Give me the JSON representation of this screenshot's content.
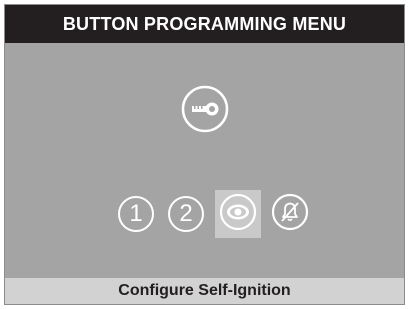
{
  "header": {
    "title": "BUTTON PROGRAMMING MENU"
  },
  "main_icon": {
    "icon": "key-icon"
  },
  "options": [
    {
      "label": "1",
      "icon": "circled-one-icon",
      "selected": false
    },
    {
      "label": "2",
      "icon": "circled-two-icon",
      "selected": false
    },
    {
      "label": "",
      "icon": "eye-icon",
      "selected": true
    },
    {
      "label": "",
      "icon": "bell-off-icon",
      "selected": false
    }
  ],
  "footer": {
    "status": "Configure Self-Ignition"
  },
  "colors": {
    "title_bar": "#231f20",
    "screen_bg": "#a4a4a4",
    "selected_bg": "#c9c9c9",
    "footer_bg": "#d2d2d2",
    "icon_color": "#ffffff"
  }
}
